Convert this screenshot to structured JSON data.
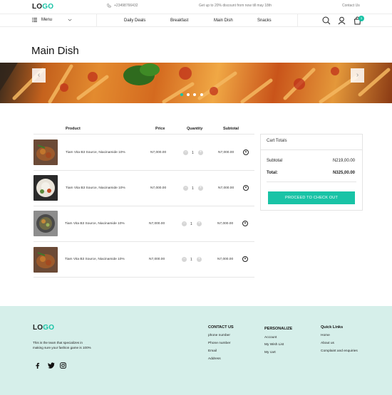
{
  "brand": {
    "logo_lo": "LO",
    "logo_go": "GO",
    "accent": "#19c3a6"
  },
  "topbar": {
    "phone": "+23498766432",
    "promo": "Get up to 20% discount from now till may 18th",
    "contact": "Contact Us"
  },
  "nav": {
    "menu_label": "Menu",
    "links": [
      "Daily Deals",
      "Breakfast",
      "Main Dish",
      "Snacks"
    ],
    "cart_count": "1"
  },
  "page": {
    "title": "Main Dish"
  },
  "cart": {
    "headers": {
      "product": "Product",
      "price": "Price",
      "quantity": "Quantity",
      "subtotal": "Subtotal"
    },
    "items": [
      {
        "name": "Tiam Vita B3 Source, Niacinamide 10%",
        "price": "N7,000.00",
        "qty": "1",
        "subtotal": "N7,000.00"
      },
      {
        "name": "Tiam Vita B3 Source, Niacinamide 10%",
        "price": "N7,000.00",
        "qty": "1",
        "subtotal": "N7,000.00"
      },
      {
        "name": "Tiam Vita B3 Source, Niacinamide 10%",
        "price": "N7,000.00",
        "qty": "1",
        "subtotal": "N7,000.00"
      },
      {
        "name": "Tiam Vita B3 Source, Niacinamide 10%",
        "price": "N7,000.00",
        "qty": "1",
        "subtotal": "N7,000.00"
      }
    ],
    "minus": "−",
    "plus": "+",
    "remove": "×"
  },
  "totals": {
    "title": "Cart Totals",
    "subtotal_label": "Subtotal",
    "subtotal_value": "N219,00.00",
    "total_label": "Total:",
    "total_value": "N325,00.00",
    "checkout": "PROCEED TO CHECK OUT"
  },
  "footer": {
    "tagline": "This is the team that specializes in making sure your fashion game is 100%",
    "contact": {
      "title": "CONTACT US",
      "links": [
        "phone number",
        "Phone number",
        "Email",
        "Address"
      ]
    },
    "personalize": {
      "title": "PERSONALIZE",
      "links": [
        "Account",
        "My Wish List",
        "My cart"
      ]
    },
    "quick": {
      "title": "Quick Links",
      "links": [
        "Home",
        "About us",
        "Complaint and enquiries"
      ]
    },
    "social_icons": [
      "facebook-icon",
      "twitter-icon",
      "instagram-icon"
    ]
  }
}
